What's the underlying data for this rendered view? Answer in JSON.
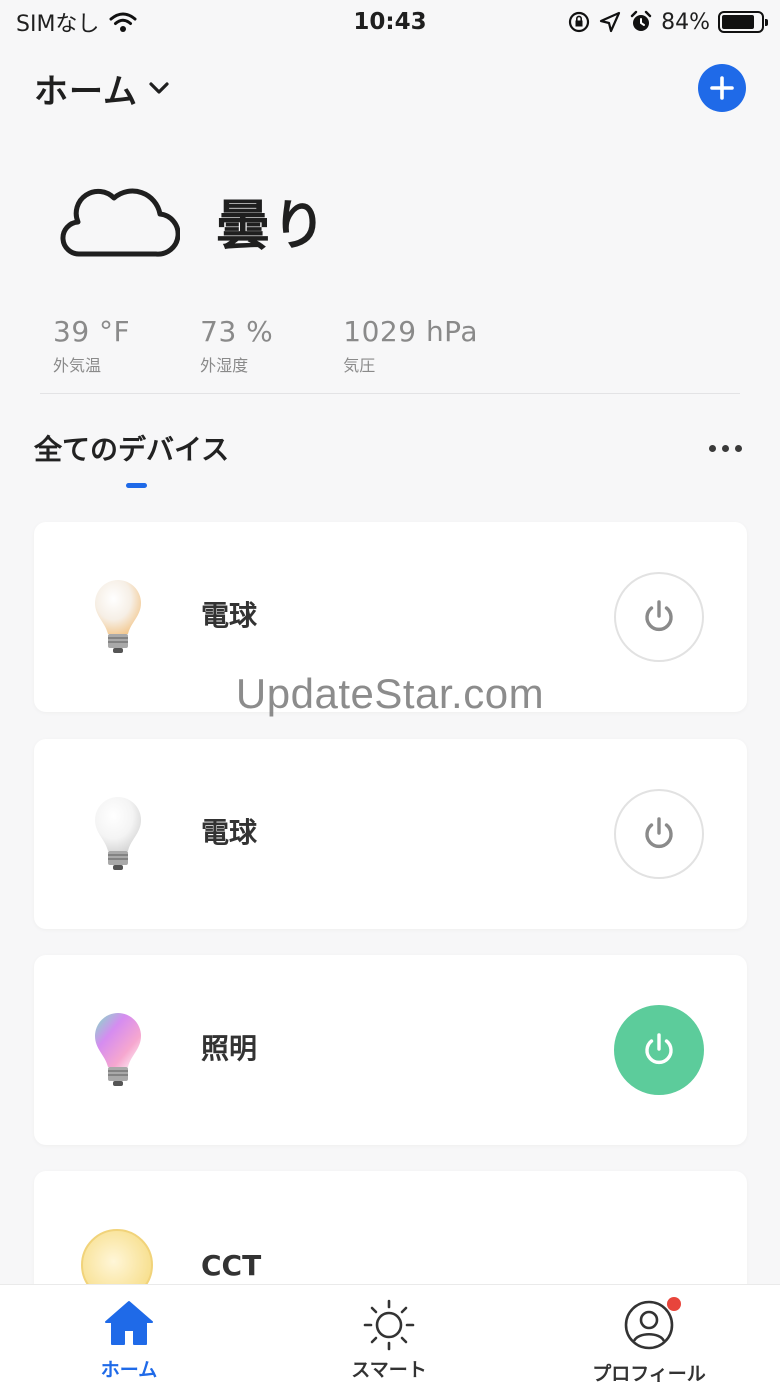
{
  "status_bar": {
    "carrier": "SIMなし",
    "time": "10:43",
    "battery_percent": "84%",
    "battery_level": 0.84
  },
  "header": {
    "home_title": "ホーム",
    "dropdown_icon": "chevron-down-icon",
    "add_icon": "plus-icon",
    "accent_color": "#1f6ae8"
  },
  "weather": {
    "icon": "cloud-icon",
    "condition": "曇り",
    "stats": [
      {
        "value": "39 °F",
        "label": "外気温"
      },
      {
        "value": "73 %",
        "label": "外湿度"
      },
      {
        "value": "1029 hPa",
        "label": "気圧"
      }
    ]
  },
  "section": {
    "title": "全てのデバイス",
    "more_icon": "more-dots-icon"
  },
  "devices": [
    {
      "name": "電球",
      "icon": "bulb-warm-icon",
      "power": "off"
    },
    {
      "name": "電球",
      "icon": "bulb-white-icon",
      "power": "off"
    },
    {
      "name": "照明",
      "icon": "bulb-rgb-icon",
      "power": "on",
      "on_color": "#5ccc9b"
    },
    {
      "name": "CCT",
      "icon": "cct-light-icon",
      "power": "unknown"
    }
  ],
  "watermark": "UpdateStar.com",
  "tab_bar": {
    "tabs": [
      {
        "label": "ホーム",
        "icon": "home-icon",
        "active": true
      },
      {
        "label": "スマート",
        "icon": "sun-icon",
        "active": false
      },
      {
        "label": "プロフィール",
        "icon": "profile-icon",
        "active": false,
        "badge": true
      }
    ],
    "badge_color": "#e8453c"
  }
}
